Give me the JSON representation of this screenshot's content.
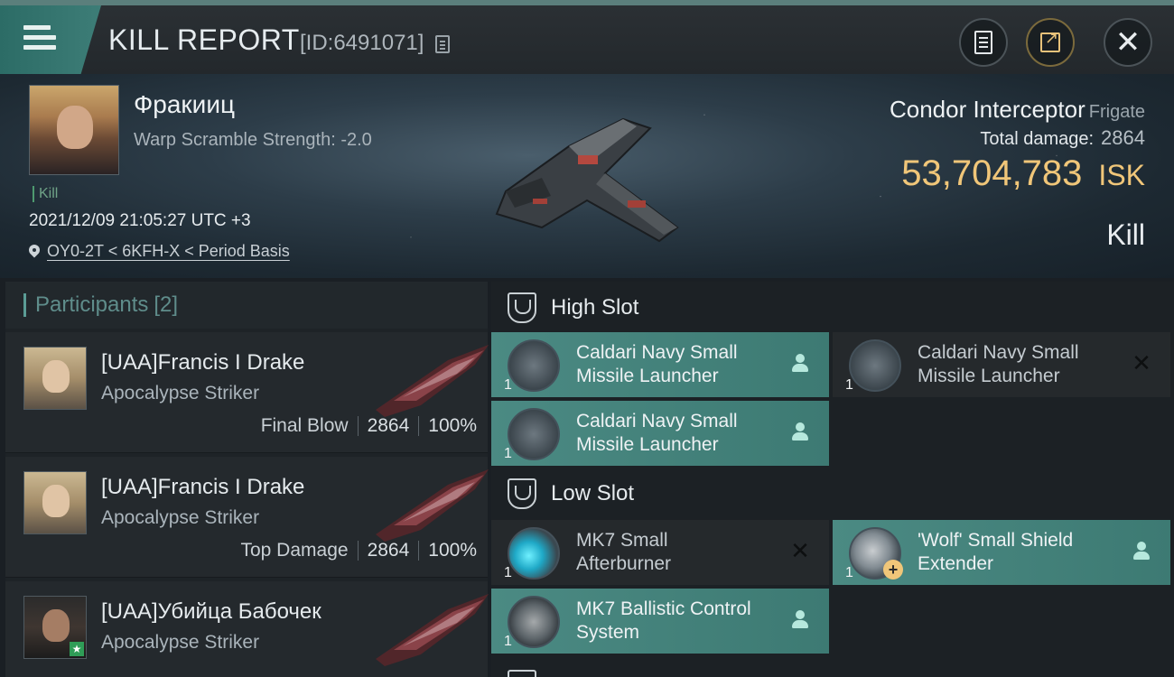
{
  "header": {
    "title": "KILL REPORT",
    "id_text": "[ID:6491071]"
  },
  "victim": {
    "name": "Фракииц",
    "stat": "Warp Scramble Strength: -2.0",
    "tag": "Kill",
    "time": "2021/12/09 21:05:27 UTC +3",
    "location": "OY0-2T < 6KFH-X < Period Basis",
    "ship_name": "Condor Interceptor",
    "ship_class": "Frigate",
    "total_damage_label": "Total damage:",
    "total_damage": "2864",
    "isk_value": "53,704,783",
    "isk_unit": "ISK",
    "result": "Kill"
  },
  "participants": {
    "title": "Participants",
    "count": "[2]",
    "rows": [
      {
        "name": "[UAA]Francis I Drake",
        "ship": "Apocalypse Striker",
        "role": "Final Blow",
        "damage": "2864",
        "percent": "100%"
      },
      {
        "name": "[UAA]Francis I Drake",
        "ship": "Apocalypse Striker",
        "role": "Top Damage",
        "damage": "2864",
        "percent": "100%"
      },
      {
        "name": "[UAA]Убийца Бабочек",
        "ship": "Apocalypse Striker"
      }
    ]
  },
  "fitting": {
    "high_slot": {
      "title": "High Slot",
      "modules": [
        {
          "line1": "Caldari Navy Small",
          "line2": "Missile Launcher",
          "qty": "1",
          "state": "user"
        },
        {
          "line1": "Caldari Navy Small",
          "line2": "Missile Launcher",
          "qty": "1",
          "state": "x"
        },
        {
          "line1": "Caldari Navy Small",
          "line2": "Missile Launcher",
          "qty": "1",
          "state": "user"
        }
      ]
    },
    "low_slot": {
      "title": "Low Slot",
      "modules": [
        {
          "line1": "MK7 Small",
          "line2": "Afterburner",
          "qty": "1",
          "state": "x"
        },
        {
          "line1": "'Wolf' Small Shield",
          "line2": "Extender",
          "qty": "1",
          "state": "user"
        },
        {
          "line1": "MK7 Ballistic Control",
          "line2": "System",
          "qty": "1",
          "state": "user"
        }
      ]
    }
  },
  "colors": {
    "accent_teal": "#3d7a73",
    "isk_gold": "#f0c679",
    "kill_green": "#4e9a6f"
  },
  "icons": {
    "menu": "hamburger-menu-icon",
    "copy": "copy-icon",
    "report": "document-icon",
    "share": "share-icon",
    "close": "close-icon",
    "location": "location-pin-icon",
    "slot": "slot-shield-icon",
    "module_state_active": "user-icon",
    "module_state_destroyed": "close-icon"
  }
}
